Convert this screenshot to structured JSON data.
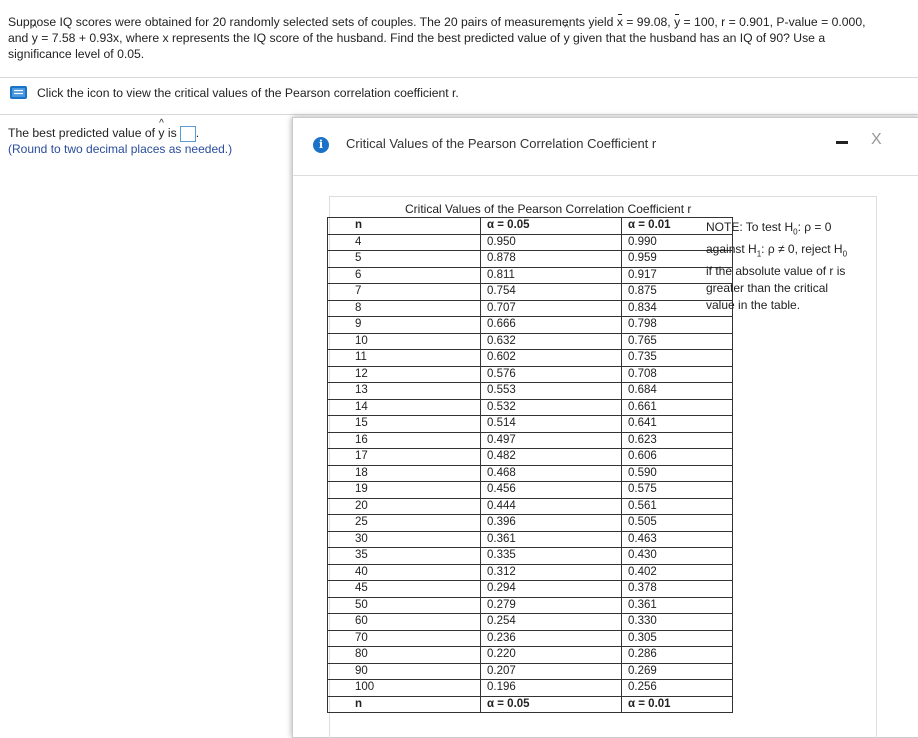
{
  "question": {
    "line1_a": "Suppose IQ scores were obtained for 20 randomly selected sets of couples. The 20 pairs of measurements yield ",
    "xbar_sym": "x",
    "line1_b": " = 99.08, ",
    "ybar_sym": "y",
    "line1_c": " = 100, r = 0.901, P-value = 0.000,",
    "line2_a": "and ",
    "yhat_sym": "y",
    "line2_b": " = 7.58 + 0.93x, where x represents the IQ score of the husband. Find the best predicted value of ",
    "yhat_sym2": "y",
    "line2_c": " given that the husband has an IQ of 90? Use a",
    "line3": "significance level of 0.05."
  },
  "icon_link": {
    "icon": "book-icon",
    "text": "Click the icon to view the critical values of the Pearson correlation coefficient r."
  },
  "answer": {
    "prefix": "The best predicted value of ",
    "yhat_sym": "y",
    "suffix": " is",
    "period": ".",
    "value": "",
    "note": "(Round to two decimal places as needed.)"
  },
  "popup": {
    "title": "Critical Values of the Pearson Correlation Coefficient r",
    "info_icon": "i",
    "close": "X",
    "table_title": "Critical Values of the Pearson Correlation Coefficient r",
    "col_n": "n",
    "col_a05": "α = 0.05",
    "col_a01": "α = 0.01",
    "rows": [
      [
        "4",
        "0.950",
        "0.990"
      ],
      [
        "5",
        "0.878",
        "0.959"
      ],
      [
        "6",
        "0.811",
        "0.917"
      ],
      [
        "7",
        "0.754",
        "0.875"
      ],
      [
        "8",
        "0.707",
        "0.834"
      ],
      [
        "9",
        "0.666",
        "0.798"
      ],
      [
        "10",
        "0.632",
        "0.765"
      ],
      [
        "11",
        "0.602",
        "0.735"
      ],
      [
        "12",
        "0.576",
        "0.708"
      ],
      [
        "13",
        "0.553",
        "0.684"
      ],
      [
        "14",
        "0.532",
        "0.661"
      ],
      [
        "15",
        "0.514",
        "0.641"
      ],
      [
        "16",
        "0.497",
        "0.623"
      ],
      [
        "17",
        "0.482",
        "0.606"
      ],
      [
        "18",
        "0.468",
        "0.590"
      ],
      [
        "19",
        "0.456",
        "0.575"
      ],
      [
        "20",
        "0.444",
        "0.561"
      ],
      [
        "25",
        "0.396",
        "0.505"
      ],
      [
        "30",
        "0.361",
        "0.463"
      ],
      [
        "35",
        "0.335",
        "0.430"
      ],
      [
        "40",
        "0.312",
        "0.402"
      ],
      [
        "45",
        "0.294",
        "0.378"
      ],
      [
        "50",
        "0.279",
        "0.361"
      ],
      [
        "60",
        "0.254",
        "0.330"
      ],
      [
        "70",
        "0.236",
        "0.305"
      ],
      [
        "80",
        "0.220",
        "0.286"
      ],
      [
        "90",
        "0.207",
        "0.269"
      ],
      [
        "100",
        "0.196",
        "0.256"
      ]
    ],
    "note": {
      "p1": "NOTE: To test H",
      "s0": "0",
      "p2": ": ρ = 0",
      "p3": "against H",
      "s1": "1",
      "p4": ": ρ ≠ 0, reject H",
      "s2": "0",
      "p5": "if the absolute value of r is greater than the critical value in the table."
    }
  },
  "colors": {
    "accent": "#1a73c8",
    "note_blue": "#2a4d9b",
    "input_border": "#5b9bd5"
  }
}
